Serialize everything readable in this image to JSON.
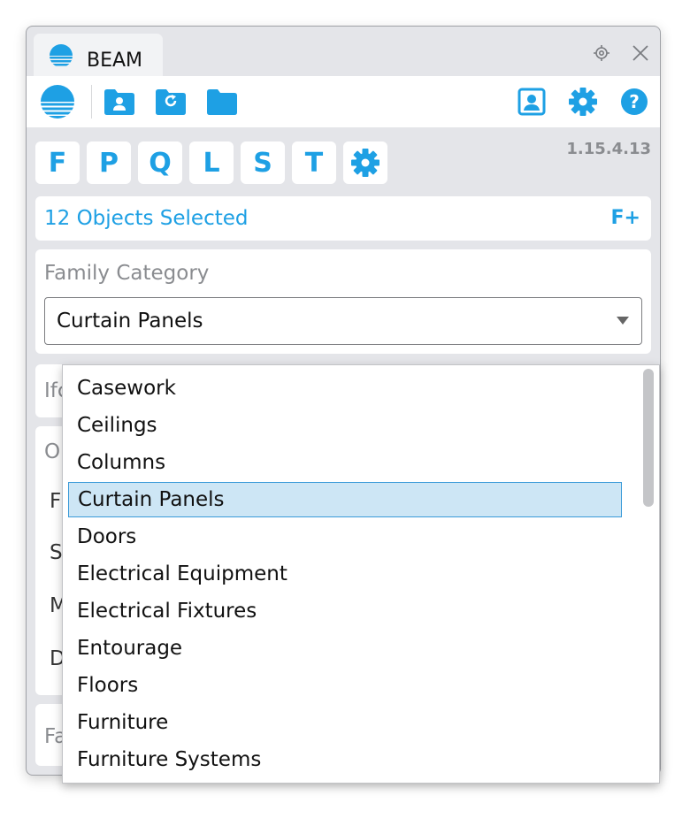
{
  "window": {
    "tab_title": "BEAM",
    "version": "1.15.4.13",
    "accent": "#1ea0e4"
  },
  "toolbar": {
    "icons": [
      "beam-logo-icon",
      "user-folder-icon",
      "refresh-folder-icon",
      "folder-icon",
      "user-card-icon",
      "gear-icon",
      "help-icon"
    ]
  },
  "letters": [
    "F",
    "P",
    "Q",
    "L",
    "S",
    "T"
  ],
  "selection": {
    "text": "12 Objects Selected",
    "action": "F+"
  },
  "family_category": {
    "label": "Family Category",
    "value": "Curtain Panels"
  },
  "clipped": {
    "ifc_prefix": "Ifc",
    "o_prefix": "O",
    "row1": "F",
    "row2": "S",
    "row3": "M",
    "row4": "D",
    "fa_prefix": "Fa"
  },
  "dropdown": {
    "options": [
      "Casework",
      "Ceilings",
      "Columns",
      "Curtain Panels",
      "Doors",
      "Electrical Equipment",
      "Electrical Fixtures",
      "Entourage",
      "Floors",
      "Furniture",
      "Furniture Systems"
    ],
    "selected": "Curtain Panels"
  }
}
